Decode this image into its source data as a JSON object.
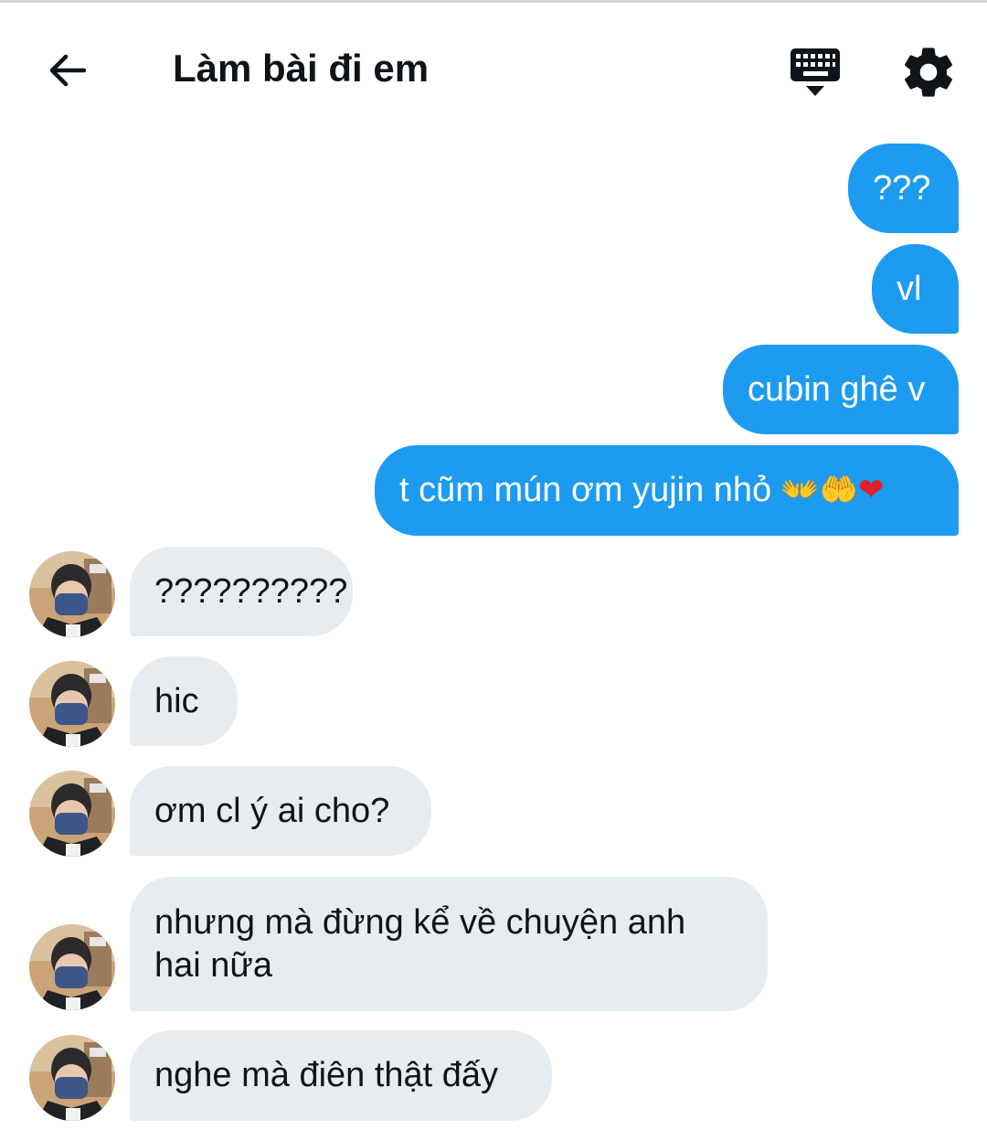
{
  "header": {
    "title": "Làm bài đi em",
    "back_icon": "arrow-left-icon",
    "keyboard_icon": "keyboard-icon",
    "settings_icon": "gear-icon"
  },
  "colors": {
    "outgoing_bubble": "#1d9bf0",
    "incoming_bubble": "#e6ecf0",
    "text": "#0f1419"
  },
  "messages": [
    {
      "direction": "outgoing",
      "text": "???"
    },
    {
      "direction": "outgoing",
      "text": "vl"
    },
    {
      "direction": "outgoing",
      "text": "cubin ghê v"
    },
    {
      "direction": "outgoing",
      "text": "t cũm mún ơm yujin nhỏ",
      "emojis": [
        "👐",
        "🤲",
        "❤"
      ]
    },
    {
      "direction": "incoming",
      "text": "??????????"
    },
    {
      "direction": "incoming",
      "text": "hic"
    },
    {
      "direction": "incoming",
      "text": "ơm cl ý ai cho?"
    },
    {
      "direction": "incoming",
      "text": "nhưng mà đừng kể về chuyện anh hai nữa"
    },
    {
      "direction": "incoming",
      "text": "nghe mà điên thật đấy"
    }
  ]
}
